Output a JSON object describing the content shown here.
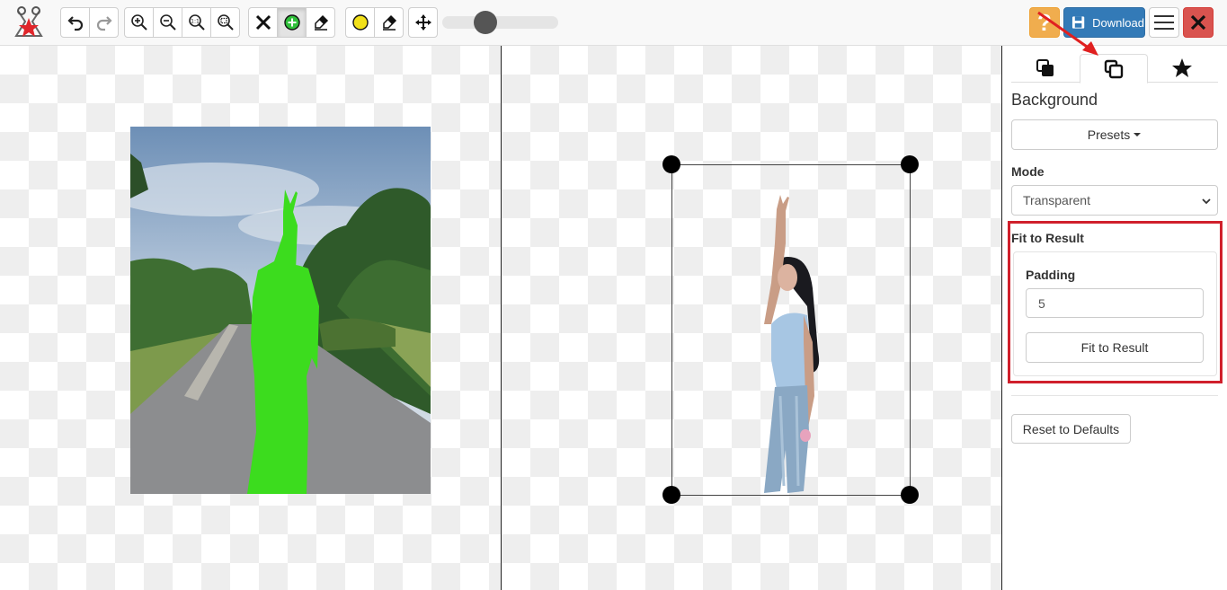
{
  "toolbar": {
    "icons": [
      "logo-icon",
      "undo-icon",
      "redo-icon",
      "zoom-in-icon",
      "zoom-out-icon",
      "zoom-actual-icon",
      "zoom-fit-icon",
      "clear-icon",
      "add-foreground-icon",
      "erase-foreground-icon",
      "add-background-icon",
      "erase-background-icon",
      "pan-icon"
    ],
    "brush_size_fraction": 0.34,
    "help_label": "?",
    "download_label": "Download"
  },
  "panel": {
    "tabs": [
      "copy-icon",
      "copy-alt-icon",
      "star-icon"
    ],
    "active_tab": 1,
    "title": "Background",
    "presets_label": "Presets",
    "mode_label": "Mode",
    "mode_value": "Transparent",
    "fit_section_label": "Fit to Result",
    "padding_label": "Padding",
    "padding_value": "5",
    "fit_button_label": "Fit to Result",
    "reset_button_label": "Reset to Defaults"
  },
  "colors": {
    "help": "#f0ad4e",
    "download": "#337ab7",
    "close": "#d9534f",
    "highlight": "#d0202c",
    "mask_green": "#3cdc1e"
  }
}
